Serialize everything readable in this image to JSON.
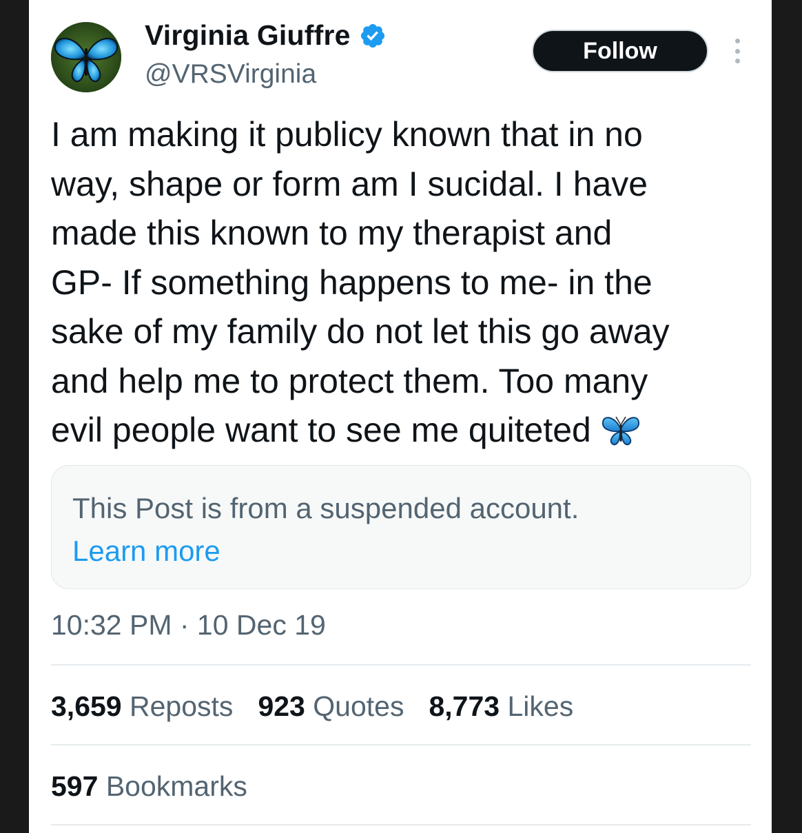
{
  "author": {
    "name": "Virginia Giuffre",
    "handle": "@VRSVirginia",
    "verified": true,
    "avatar_icon": "blue-butterfly-icon"
  },
  "actions": {
    "follow_label": "Follow",
    "more_icon": "more-vertical-icon"
  },
  "tweet": {
    "text": "I am making it publicy known that in no\nway, shape or form am I sucidal. I have\nmade this known to my therapist and\nGP- If something happens to me- in the\nsake of my family do not let this go away\nand help me to protect them. Too many\nevil people want to see me quiteted",
    "emoji_icon": "blue-butterfly-emoji"
  },
  "notice": {
    "message": "This Post is from a suspended account.",
    "link": "Learn more"
  },
  "meta": {
    "timestamp": "10:32 PM · 10 Dec 19"
  },
  "stats": {
    "reposts_count": "3,659",
    "reposts_label": "Reposts",
    "quotes_count": "923",
    "quotes_label": "Quotes",
    "likes_count": "8,773",
    "likes_label": "Likes",
    "bookmarks_count": "597",
    "bookmarks_label": "Bookmarks"
  },
  "colors": {
    "accent": "#1d9bf0",
    "text": "#0f1419",
    "secondary": "#536471"
  }
}
